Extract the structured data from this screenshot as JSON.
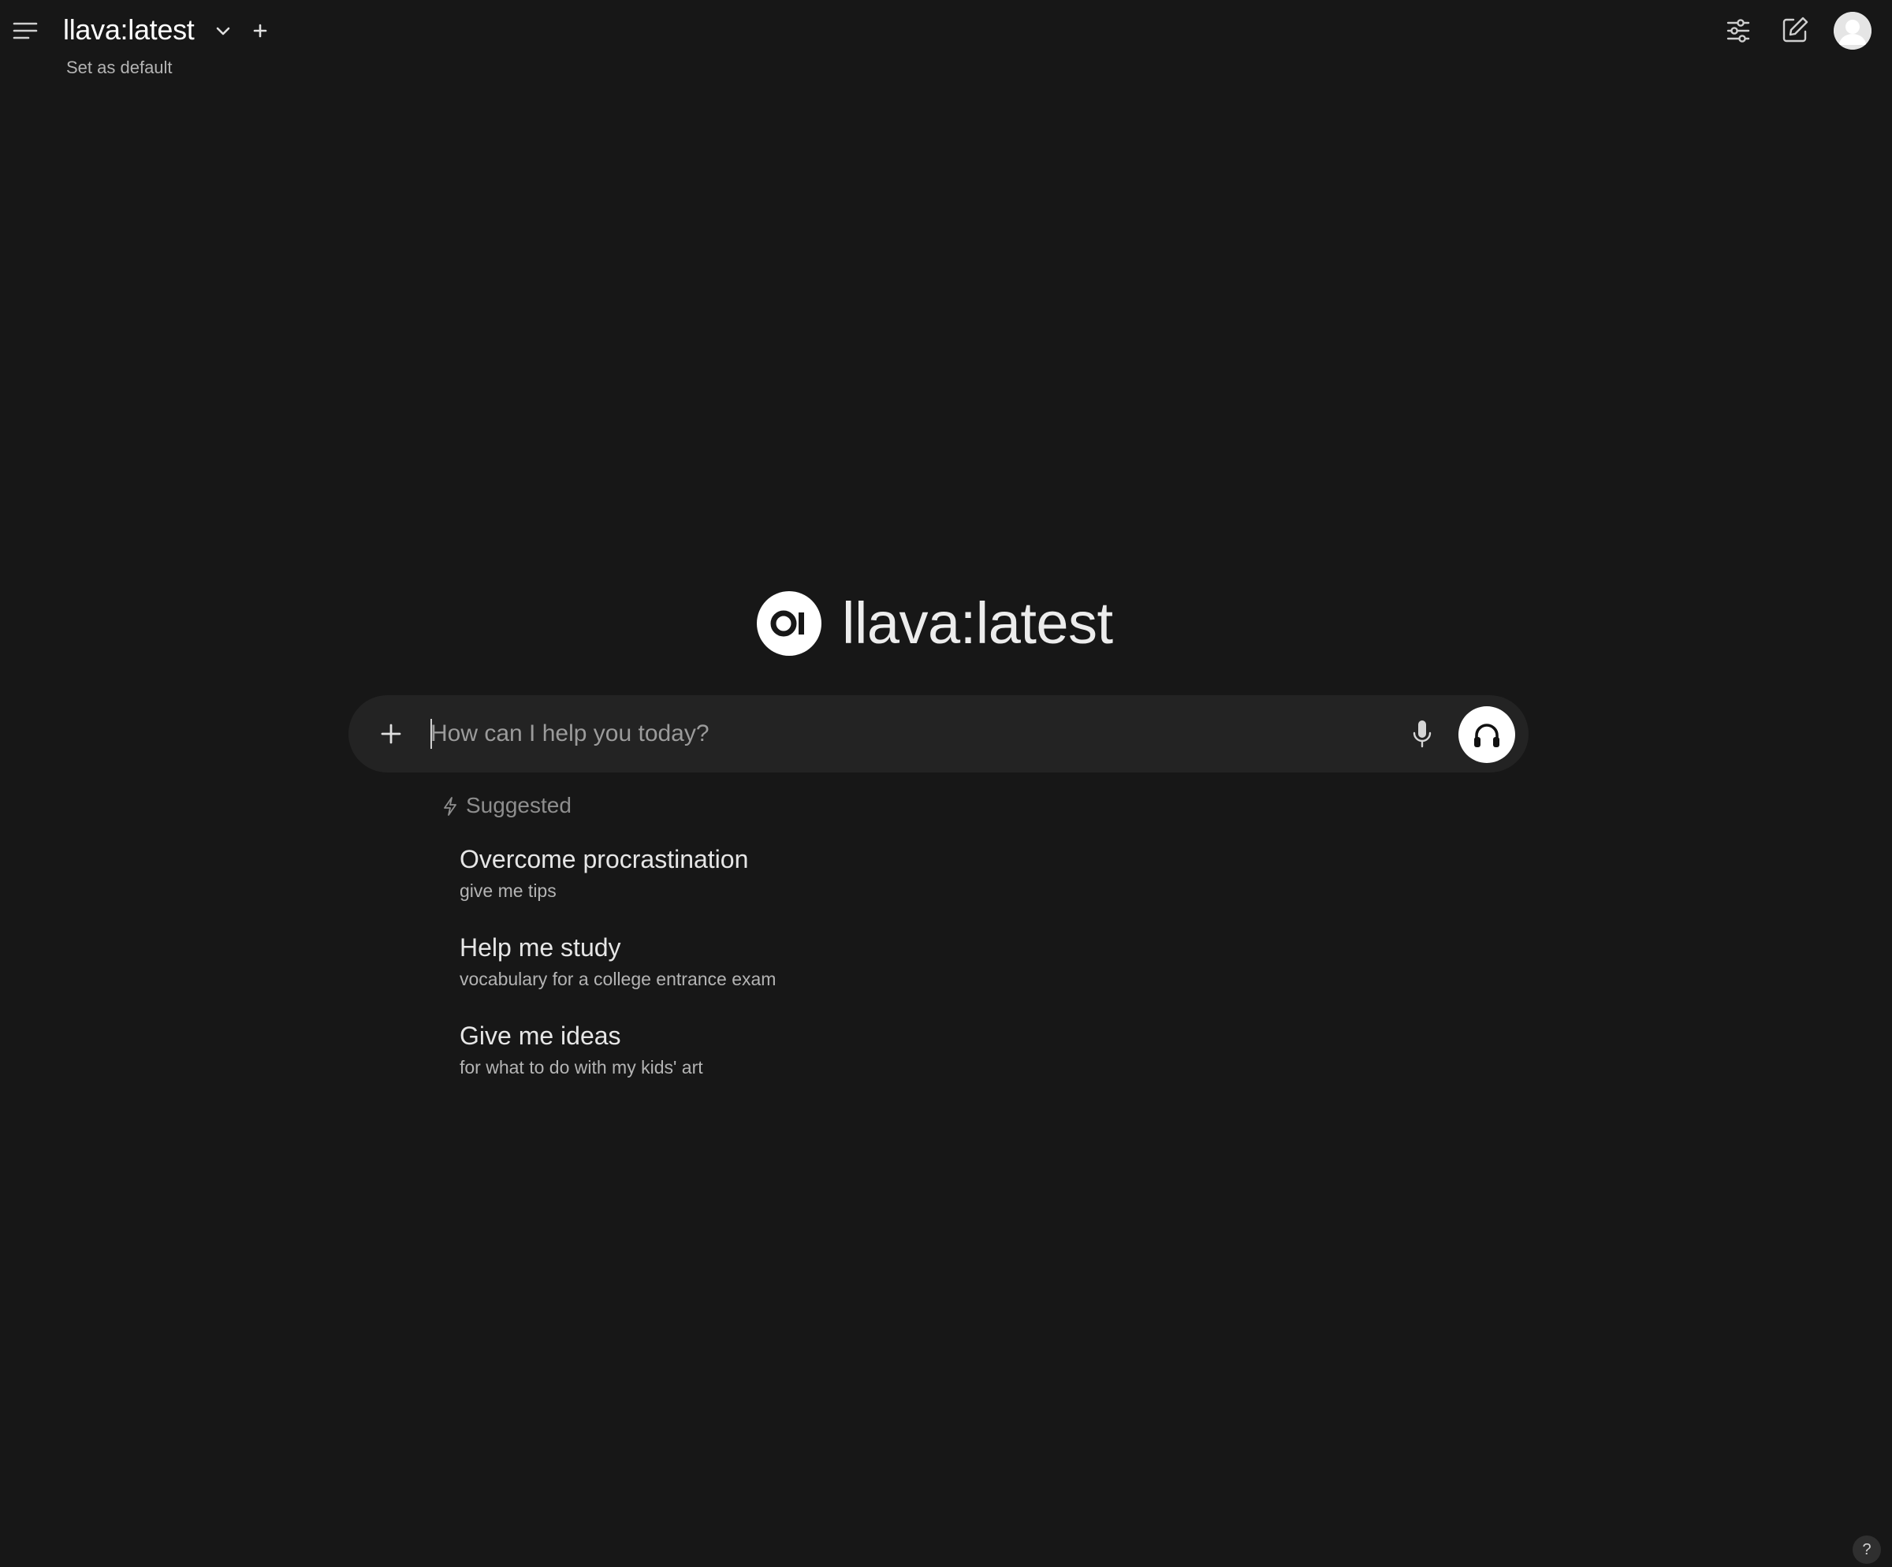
{
  "header": {
    "menu_icon": "hamburger-menu-icon",
    "model_name": "llava:latest",
    "dropdown_icon": "chevron-down-icon",
    "add_model_icon": "plus-icon",
    "set_default_label": "Set as default",
    "controls_icon": "sliders-icon",
    "new_chat_icon": "edit-pencil-icon",
    "avatar_icon": "user-avatar-icon"
  },
  "hero": {
    "logo_text": "OI",
    "title": "llava:latest"
  },
  "composer": {
    "placeholder": "How can I help you today?",
    "value": "",
    "attach_icon": "plus-icon",
    "mic_icon": "microphone-icon",
    "voice_icon": "headphones-icon"
  },
  "suggestions": {
    "heading": "Suggested",
    "heading_icon": "bolt-icon",
    "items": [
      {
        "title": "Overcome procrastination",
        "subtitle": "give me tips"
      },
      {
        "title": "Help me study",
        "subtitle": "vocabulary for a college entrance exam"
      },
      {
        "title": "Give me ideas",
        "subtitle": "for what to do with my kids' art"
      }
    ]
  },
  "help": {
    "label": "?"
  },
  "colors": {
    "background": "#171717",
    "input_background": "#232323",
    "text_primary": "#ececec",
    "text_muted": "#b4b4b4",
    "accent": "#ffffff"
  }
}
